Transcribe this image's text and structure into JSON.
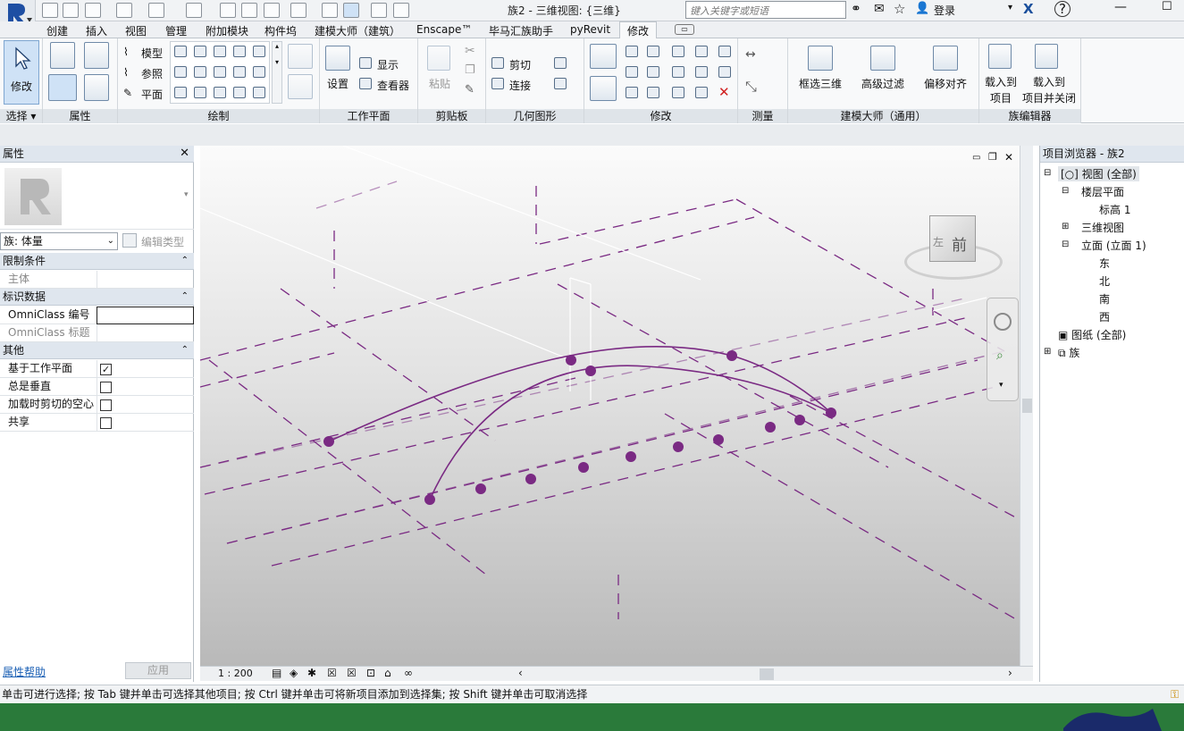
{
  "app": {
    "title": "族2 - 三维视图: {三维}"
  },
  "search": {
    "placeholder": "键入关键字或短语"
  },
  "user": {
    "login": "登录"
  },
  "tabs": [
    "创建",
    "插入",
    "视图",
    "管理",
    "附加模块",
    "构件坞",
    "建模大师（建筑）",
    "Enscape™",
    "毕马汇族助手",
    "pyRevit",
    "修改"
  ],
  "ribbon": {
    "select": {
      "button": "修改",
      "title": "选择"
    },
    "properties": {
      "title": "属性"
    },
    "draw": {
      "title": "绘制",
      "model": "模型",
      "ref": "参照",
      "plane": "平面"
    },
    "workplane": {
      "title": "工作平面",
      "set": "设置",
      "show": "显示",
      "viewer": "查看器"
    },
    "clipboard": {
      "title": "剪贴板",
      "paste": "粘贴"
    },
    "geometry": {
      "title": "几何图形",
      "cut": "剪切",
      "join": "连接"
    },
    "modify": {
      "title": "修改"
    },
    "measure": {
      "title": "测量"
    },
    "master": {
      "title": "建模大师（通用）",
      "b1": "框选三维",
      "b2": "高级过滤",
      "b3": "偏移对齐"
    },
    "family": {
      "title": "族编辑器",
      "b1a": "载入到",
      "b1b": "项目",
      "b2a": "载入到",
      "b2b": "项目并关闭"
    }
  },
  "props": {
    "title": "属性",
    "type": "族: 体量",
    "edit_type": "编辑类型",
    "sections": {
      "constraints": "限制条件",
      "identity": "标识数据",
      "other": "其他"
    },
    "rows": {
      "host": "主体",
      "omni_num": "OmniClass 编号",
      "omni_title": "OmniClass 标题",
      "workplane_based": "基于工作平面",
      "always_vertical": "总是垂直",
      "cut_void": "加载时剪切的空心",
      "shared": "共享"
    },
    "checks": {
      "workplane_based": true,
      "always_vertical": false,
      "cut_void": false,
      "shared": false
    },
    "help": "属性帮助",
    "apply": "应用"
  },
  "viewport": {
    "scale": "1 : 200",
    "cube_front": "前",
    "cube_left": "左"
  },
  "browser": {
    "title": "项目浏览器 - 族2",
    "nodes": {
      "views": "视图 (全部)",
      "floorplans": "楼层平面",
      "level1": "标高 1",
      "3d": "三维视图",
      "elevations": "立面 (立面 1)",
      "east": "东",
      "north": "北",
      "south": "南",
      "west": "西",
      "sheets": "图纸 (全部)",
      "families": "族"
    }
  },
  "status": {
    "text": "单击可进行选择; 按 Tab 键并单击可选择其他项目; 按 Ctrl 键并单击可将新项目添加到选择集; 按 Shift 键并单击可取消选择"
  },
  "colors": {
    "accent": "#7a2a83",
    "ribbon_bg": "#f8f9fa",
    "panel_title": "#dfe4e9"
  }
}
